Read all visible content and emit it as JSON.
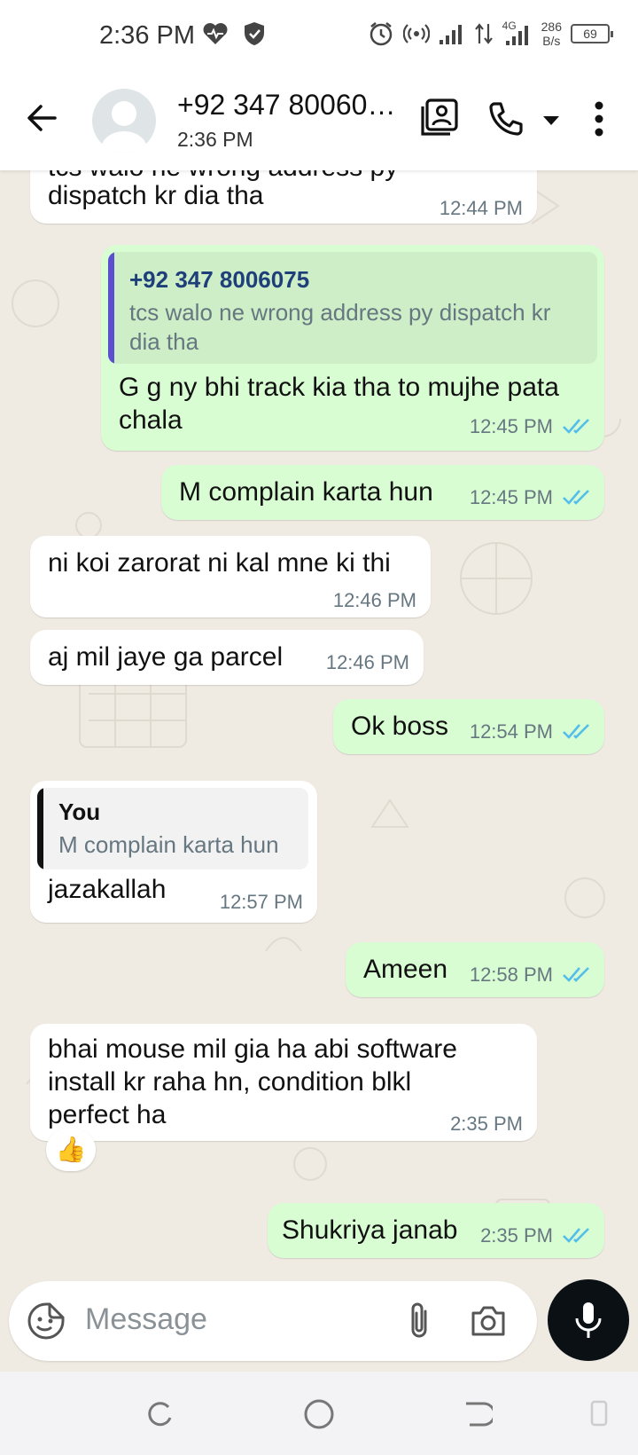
{
  "status_bar": {
    "time": "2:36 PM",
    "network_speed_value": "286",
    "network_speed_unit": "B/s",
    "network_type": "4G",
    "battery": "69"
  },
  "header": {
    "contact_name": "+92 347 80060…",
    "contact_status": "2:36 PM"
  },
  "messages": [
    {
      "direction": "in",
      "text_partial": "tcs walo ne wrong address py",
      "text": "dispatch kr dia tha",
      "time": "12:44 PM"
    },
    {
      "direction": "out",
      "quote_author": "+92 347 8006075",
      "quote_text_1": "tcs walo ne wrong address py dispatch kr",
      "quote_text_2": "dia tha",
      "text_1": "G g ny bhi track kia tha to mujhe pata",
      "text_2": "chala",
      "time": "12:45 PM"
    },
    {
      "direction": "out",
      "text": "M complain karta hun",
      "time": "12:45 PM"
    },
    {
      "direction": "in",
      "text": "ni koi zarorat ni kal mne ki thi",
      "time": "12:46 PM"
    },
    {
      "direction": "in",
      "text": "aj mil jaye ga parcel",
      "time": "12:46 PM"
    },
    {
      "direction": "out",
      "text": "Ok boss",
      "time": "12:54 PM"
    },
    {
      "direction": "in",
      "quote_author": "You",
      "quote_text": "M complain karta hun",
      "text": "jazakallah",
      "time": "12:57 PM"
    },
    {
      "direction": "out",
      "text": "Ameen",
      "time": "12:58 PM"
    },
    {
      "direction": "in",
      "text_1": "bhai mouse mil gia ha abi software",
      "text_2": "install kr raha hn, condition blkl",
      "text_3": "perfect ha",
      "time": "2:35 PM",
      "reaction": "👍"
    },
    {
      "direction": "out",
      "text": "Shukriya janab",
      "time": "2:35 PM"
    }
  ],
  "composer": {
    "placeholder": "Message"
  },
  "colors": {
    "outgoing_bubble": "#d9fdd3",
    "incoming_bubble": "#ffffff",
    "chat_background": "#efeae2",
    "read_ticks": "#53bdeb",
    "quote_bar_contact": "#5b4fcf",
    "quote_bar_you": "#111111"
  },
  "icons": [
    "back-arrow-icon",
    "avatar-placeholder-icon",
    "contact-card-icon",
    "phone-icon",
    "dropdown-caret-icon",
    "more-vert-icon",
    "emoji-sticker-icon",
    "attach-icon",
    "camera-icon",
    "mic-icon",
    "read-ticks-icon"
  ]
}
